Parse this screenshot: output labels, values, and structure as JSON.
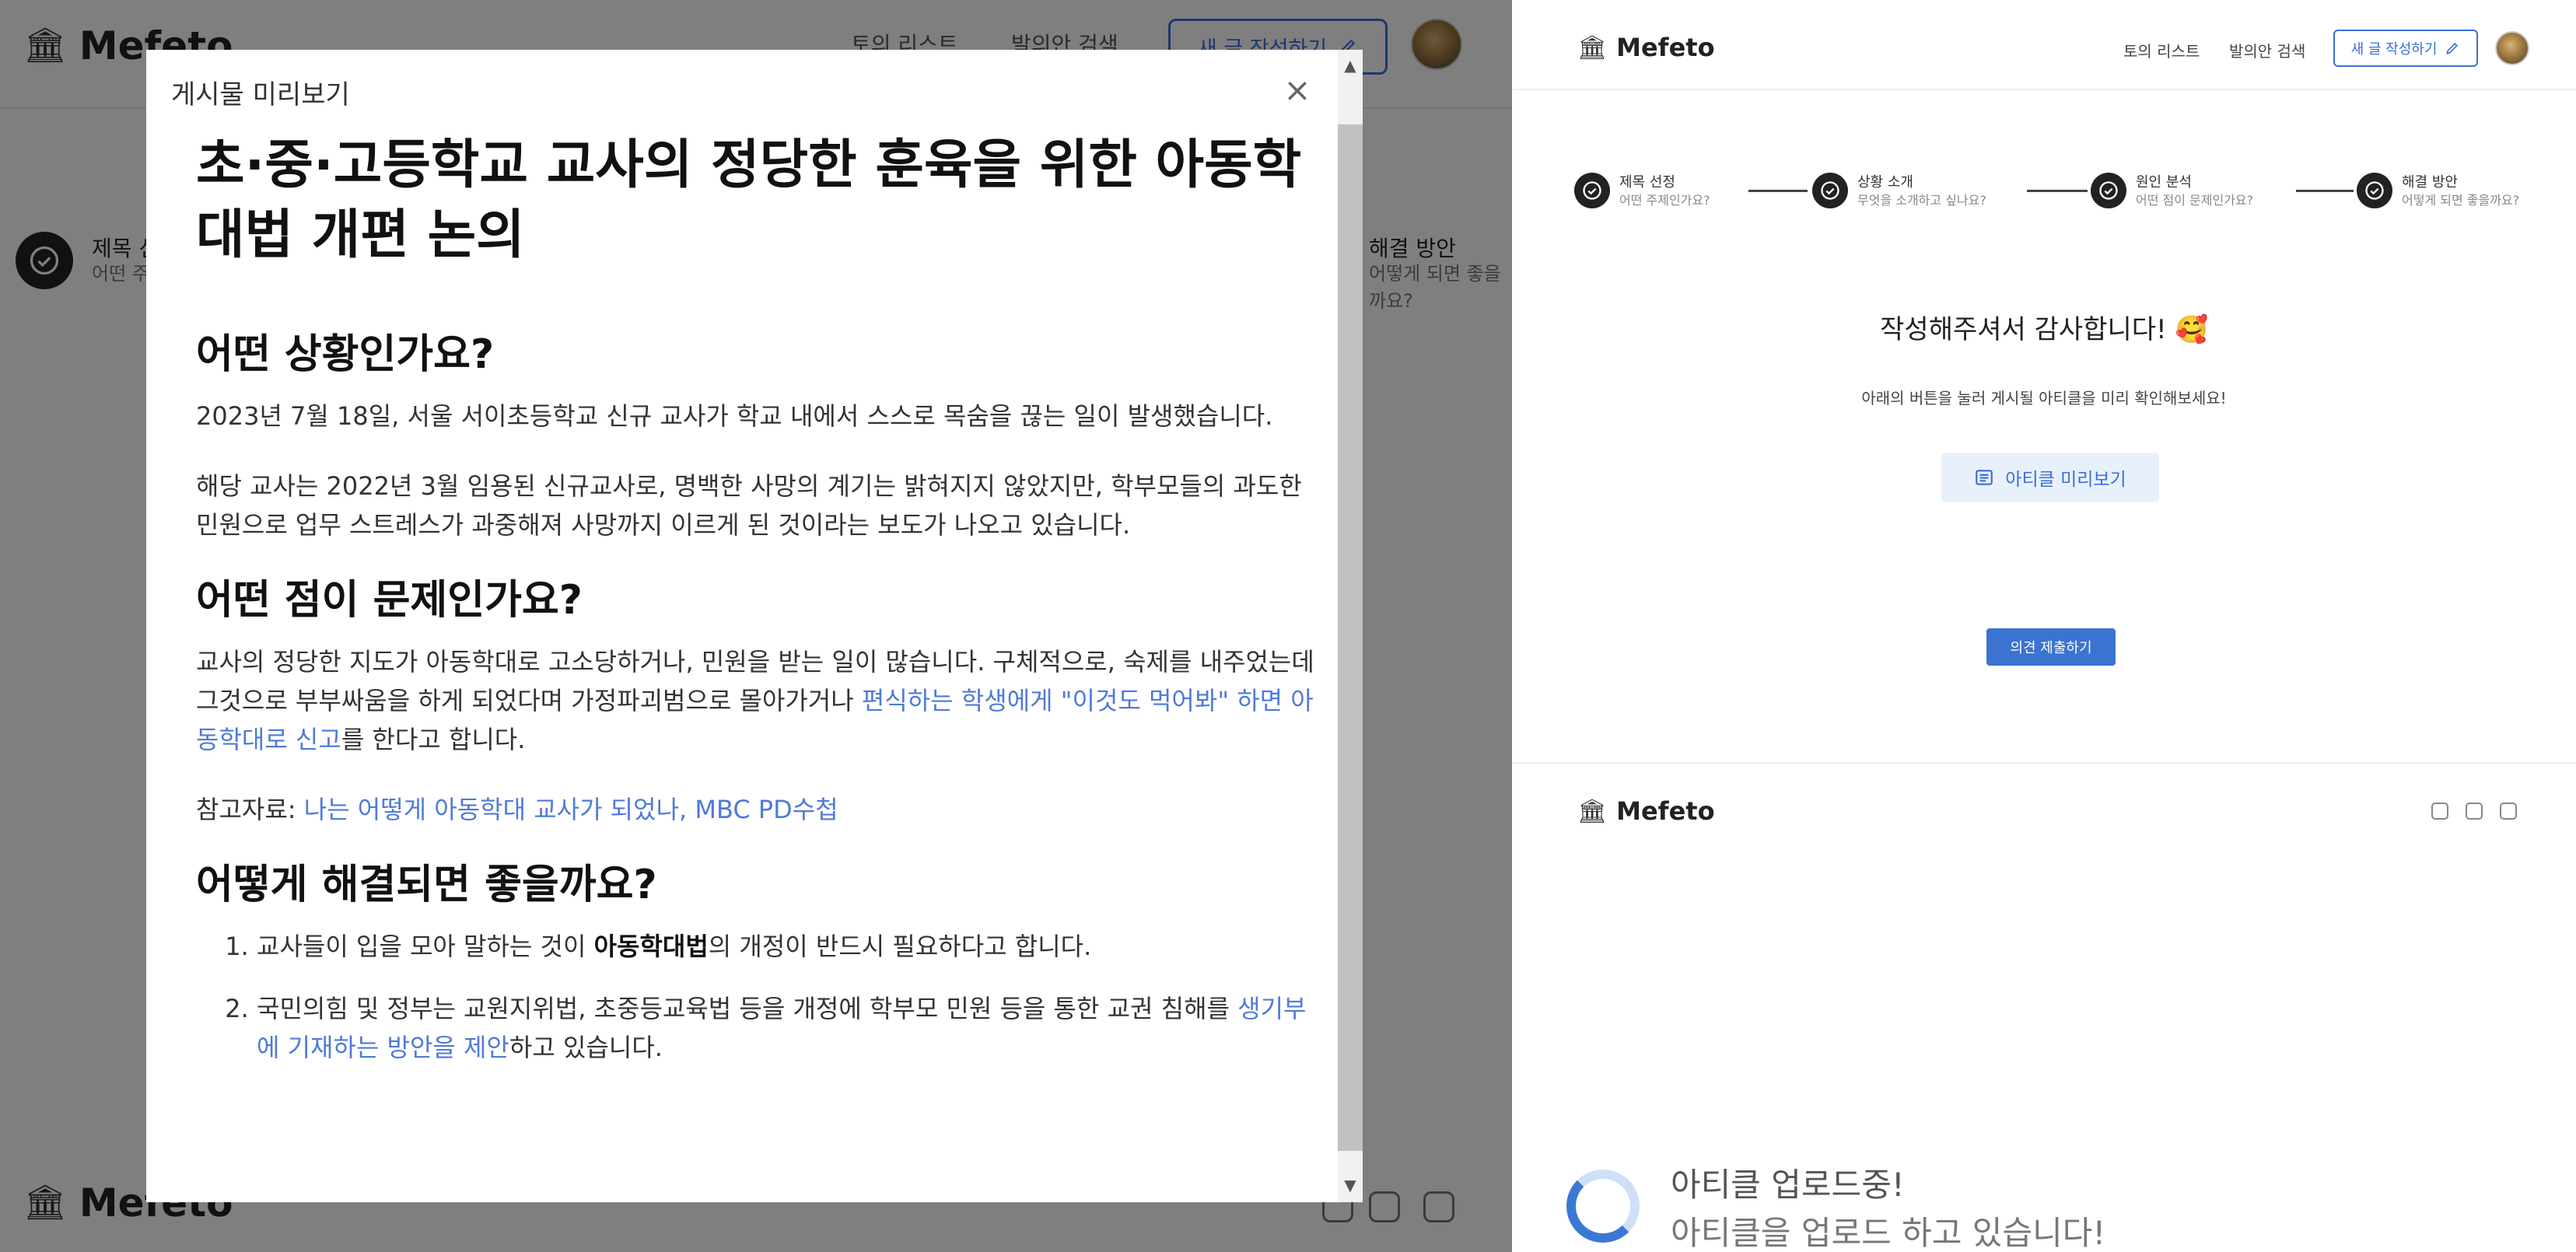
{
  "app": {
    "brand": "Mefeto",
    "nav": {
      "topic_list": "토의 리스트",
      "proposal_search": "발의안 검색",
      "new_post": "새 글 작성하기"
    }
  },
  "left_bg": {
    "nav_topic_list": "토의 리스트",
    "nav_proposal_search": "발의안 검색",
    "new_post": "새 글 작성하기",
    "step_first_title": "제목 선정",
    "step_first_sub": "어떤 주제인가요?",
    "step_last_title": "해결 방안",
    "step_last_sub": "어떻게 되면 좋을까요?"
  },
  "modal": {
    "title": "게시물 미리보기",
    "close_label": "×",
    "article": {
      "title": "초·중·고등학교 교사의 정당한 훈육을 위한 아동학대법 개편 논의",
      "sections": [
        {
          "heading": "어떤 상황인가요?",
          "paragraphs": [
            "2023년 7월 18일, 서울 서이초등학교 신규 교사가 학교 내에서 스스로 목숨을 끊는 일이 발생했습니다.",
            "해당 교사는 2022년 3월 임용된 신규교사로, 명백한 사망의 계기는 밝혀지지 않았지만, 학부모들의 과도한 민원으로 업무 스트레스가 과중해져 사망까지 이르게 된 것이라는 보도가 나오고 있습니다."
          ]
        },
        {
          "heading": "어떤 점이 문제인가요?",
          "p1_text": "교사의 정당한 지도가 아동학대로 고소당하거나, 민원을 받는 일이 많습니다. 구체적으로, 숙제를 내주었는데 그것으로 부부싸움을 하게 되었다며 가정파괴범으로 몰아가거나 ",
          "p1_link": "편식하는 학생에게 \"이것도 먹어봐\" 하면 아동학대로 신고",
          "p1_tail": "를 한다고 합니다.",
          "ref_label": "참고자료: ",
          "ref_link": "나는 어떻게 아동학대 교사가 되었나, MBC PD수첩"
        },
        {
          "heading": "어떻게 해결되면 좋을까요?",
          "item1_pre": "교사들이 입을 모아 말하는 것이 ",
          "item1_bold": "아동학대법",
          "item1_post": "의 개정이 반드시 필요하다고 합니다.",
          "item2_pre": "국민의힘 및 정부는 교원지위법, 초중등교육법 등을 개정에 학부모 민원 등을 통한 교권 침해를 ",
          "item2_link": "생기부에 기재하는 방안을 제안",
          "item2_post": "하고 있습니다."
        }
      ]
    }
  },
  "right": {
    "steps": [
      {
        "title": "제목 선정",
        "sub": "어떤 주제인가요?"
      },
      {
        "title": "상황 소개",
        "sub": "무엇을 소개하고 싶나요?"
      },
      {
        "title": "원인 분석",
        "sub": "어떤 점이 문제인가요?"
      },
      {
        "title": "해결 방안",
        "sub": "어떻게 되면 좋을까요?"
      }
    ],
    "thanks": "작성해주셔서 감사합니다! 🥰",
    "subtitle": "아래의 버튼을 눌러 게시될 아티클을 미리 확인해보세요!",
    "preview_button": "아티클 미리보기",
    "submit_button": "의견 제출하기"
  },
  "toast": {
    "title": "아티클 업로드중!",
    "message": "아티클을 업로드 하고 있습니다!"
  },
  "icons": {
    "logo": "bank-building-icon",
    "edit": "pencil-icon",
    "step_done": "check-circle-icon",
    "preview": "document-lines-icon",
    "social": [
      "twitter-icon",
      "youtube-icon",
      "instagram-icon"
    ]
  },
  "colors": {
    "accent": "#3a6fd8",
    "link": "#4f7ad8",
    "overlay": "rgba(0,0,0,0.5)"
  }
}
